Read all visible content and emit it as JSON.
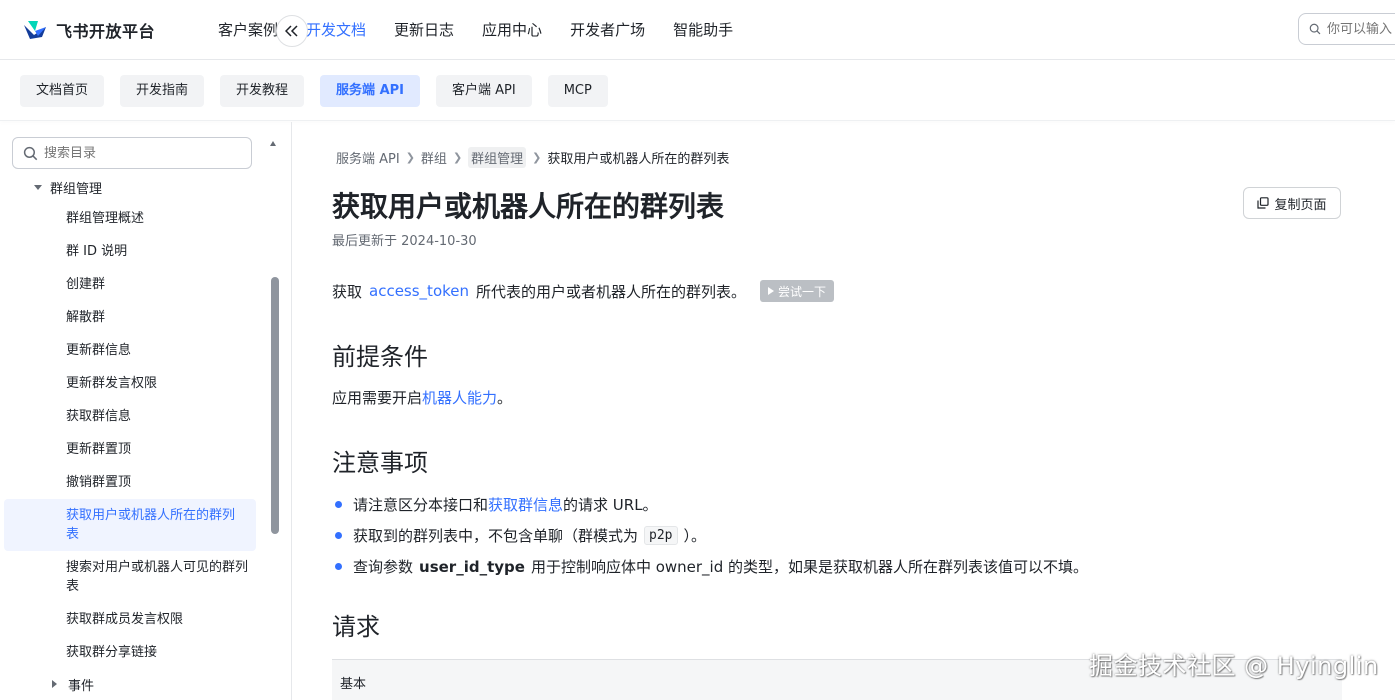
{
  "brand": {
    "name": "飞书开放平台"
  },
  "topnav": {
    "items": [
      {
        "label": "客户案例",
        "active": false
      },
      {
        "label": "开发文档",
        "active": true
      },
      {
        "label": "更新日志",
        "active": false
      },
      {
        "label": "应用中心",
        "active": false
      },
      {
        "label": "开发者广场",
        "active": false
      },
      {
        "label": "智能助手",
        "active": false
      }
    ],
    "search_placeholder": "你可以输入"
  },
  "subnav": {
    "tabs": [
      {
        "label": "文档首页",
        "active": false
      },
      {
        "label": "开发指南",
        "active": false
      },
      {
        "label": "开发教程",
        "active": false
      },
      {
        "label": "服务端 API",
        "active": true
      },
      {
        "label": "客户端 API",
        "active": false
      },
      {
        "label": "MCP",
        "active": false
      }
    ]
  },
  "sidebar": {
    "search_placeholder": "搜索目录",
    "group_label": "群组管理",
    "items": [
      {
        "label": "群组管理概述",
        "active": false
      },
      {
        "label": "群 ID 说明",
        "active": false
      },
      {
        "label": "创建群",
        "active": false
      },
      {
        "label": "解散群",
        "active": false
      },
      {
        "label": "更新群信息",
        "active": false
      },
      {
        "label": "更新群发言权限",
        "active": false
      },
      {
        "label": "获取群信息",
        "active": false
      },
      {
        "label": "更新群置顶",
        "active": false
      },
      {
        "label": "撤销群置顶",
        "active": false
      },
      {
        "label": "获取用户或机器人所在的群列表",
        "active": true
      },
      {
        "label": "搜索对用户或机器人可见的群列表",
        "active": false
      },
      {
        "label": "获取群成员发言权限",
        "active": false
      },
      {
        "label": "获取群分享链接",
        "active": false
      }
    ],
    "next_group_label": "事件"
  },
  "breadcrumb": [
    "服务端 API",
    "群组",
    "群组管理",
    "获取用户或机器人所在的群列表"
  ],
  "page": {
    "title": "获取用户或机器人所在的群列表",
    "updated": "最后更新于 2024-10-30",
    "copy_label": "复制页面",
    "desc_prefix": "获取",
    "desc_link": "access_token",
    "desc_suffix": "所代表的用户或者机器人所在的群列表。",
    "try_label": "尝试一下",
    "prereq_title": "前提条件",
    "prereq_prefix": "应用需要开启",
    "prereq_link": "机器人能力",
    "prereq_suffix": "。",
    "notes_title": "注意事项",
    "note1_prefix": "请注意区分本接口和",
    "note1_link": "获取群信息",
    "note1_suffix": "的请求 URL。",
    "note2_prefix": "获取到的群列表中，不包含单聊（群模式为",
    "note2_code": "p2p",
    "note2_suffix": "）。",
    "note3_prefix": "查询参数",
    "note3_bold": "user_id_type",
    "note3_suffix": "用于控制响应体中 owner_id 的类型，如果是获取机器人所在群列表该值可以不填。",
    "request_title": "请求",
    "table_header": "基本"
  },
  "watermark": "掘金技术社区 @ Hyinglin",
  "colors": {
    "accent": "#3370ff",
    "text": "#1f2329",
    "muted": "#646a73"
  }
}
